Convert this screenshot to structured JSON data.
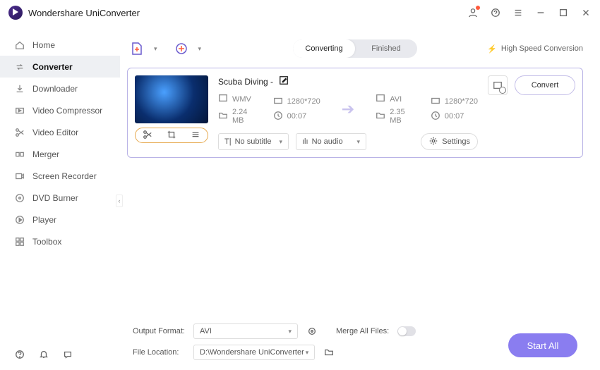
{
  "app": {
    "title": "Wondershare UniConverter"
  },
  "sidebar": {
    "items": [
      {
        "label": "Home"
      },
      {
        "label": "Converter"
      },
      {
        "label": "Downloader"
      },
      {
        "label": "Video Compressor"
      },
      {
        "label": "Video Editor"
      },
      {
        "label": "Merger"
      },
      {
        "label": "Screen Recorder"
      },
      {
        "label": "DVD Burner"
      },
      {
        "label": "Player"
      },
      {
        "label": "Toolbox"
      }
    ]
  },
  "top": {
    "tab_converting": "Converting",
    "tab_finished": "Finished",
    "high_speed": "High Speed Conversion"
  },
  "file": {
    "title": "Scuba Diving -",
    "src_format": "WMV",
    "src_res": "1280*720",
    "src_size": "2.24 MB",
    "src_dur": "00:07",
    "dst_format": "AVI",
    "dst_res": "1280*720",
    "dst_size": "2.35 MB",
    "dst_dur": "00:07",
    "subtitle": "No subtitle",
    "audio": "No audio",
    "settings": "Settings",
    "convert": "Convert"
  },
  "bottom": {
    "output_format_label": "Output Format:",
    "output_format_value": "AVI",
    "merge_label": "Merge All Files:",
    "location_label": "File Location:",
    "location_value": "D:\\Wondershare UniConverter",
    "start_all": "Start All"
  }
}
